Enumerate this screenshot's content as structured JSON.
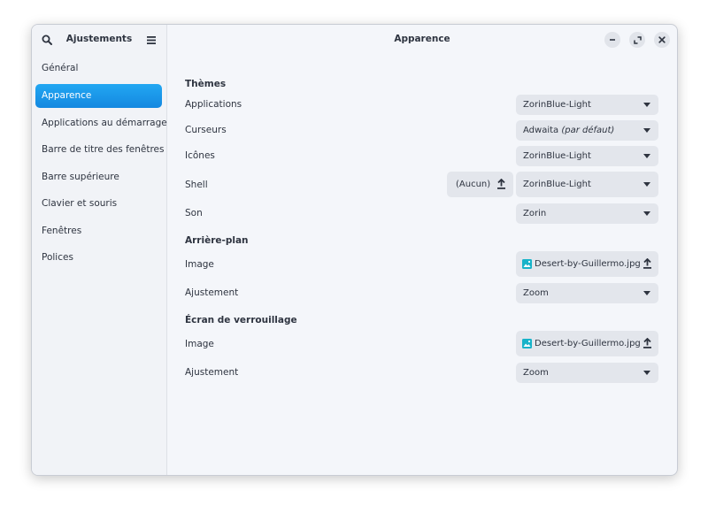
{
  "sidebar": {
    "title": "Ajustements",
    "items": [
      {
        "label": "Général"
      },
      {
        "label": "Apparence"
      },
      {
        "label": "Applications au démarrage"
      },
      {
        "label": "Barre de titre des fenêtres"
      },
      {
        "label": "Barre supérieure"
      },
      {
        "label": "Clavier et souris"
      },
      {
        "label": "Fenêtres"
      },
      {
        "label": "Polices"
      }
    ],
    "active_index": 1
  },
  "header": {
    "title": "Apparence"
  },
  "themes": {
    "heading": "Thèmes",
    "applications": {
      "label": "Applications",
      "value": "ZorinBlue-Light"
    },
    "cursors": {
      "label": "Curseurs",
      "value": "Adwaita",
      "suffix": "(par défaut)"
    },
    "icons": {
      "label": "Icônes",
      "value": "ZorinBlue-Light"
    },
    "shell": {
      "label": "Shell",
      "value": "ZorinBlue-Light",
      "button_label": "(Aucun)"
    },
    "sound": {
      "label": "Son",
      "value": "Zorin"
    }
  },
  "background": {
    "heading": "Arrière-plan",
    "image": {
      "label": "Image",
      "file": "Desert-by-Guillermo.jpg"
    },
    "adjustment": {
      "label": "Ajustement",
      "value": "Zoom"
    }
  },
  "lockscreen": {
    "heading": "Écran de verrouillage",
    "image": {
      "label": "Image",
      "file": "Desert-by-Guillermo.jpg"
    },
    "adjustment": {
      "label": "Ajustement",
      "value": "Zoom"
    }
  },
  "colors": {
    "accent": "#1a98e8",
    "image_icon": "#17b3c9"
  }
}
